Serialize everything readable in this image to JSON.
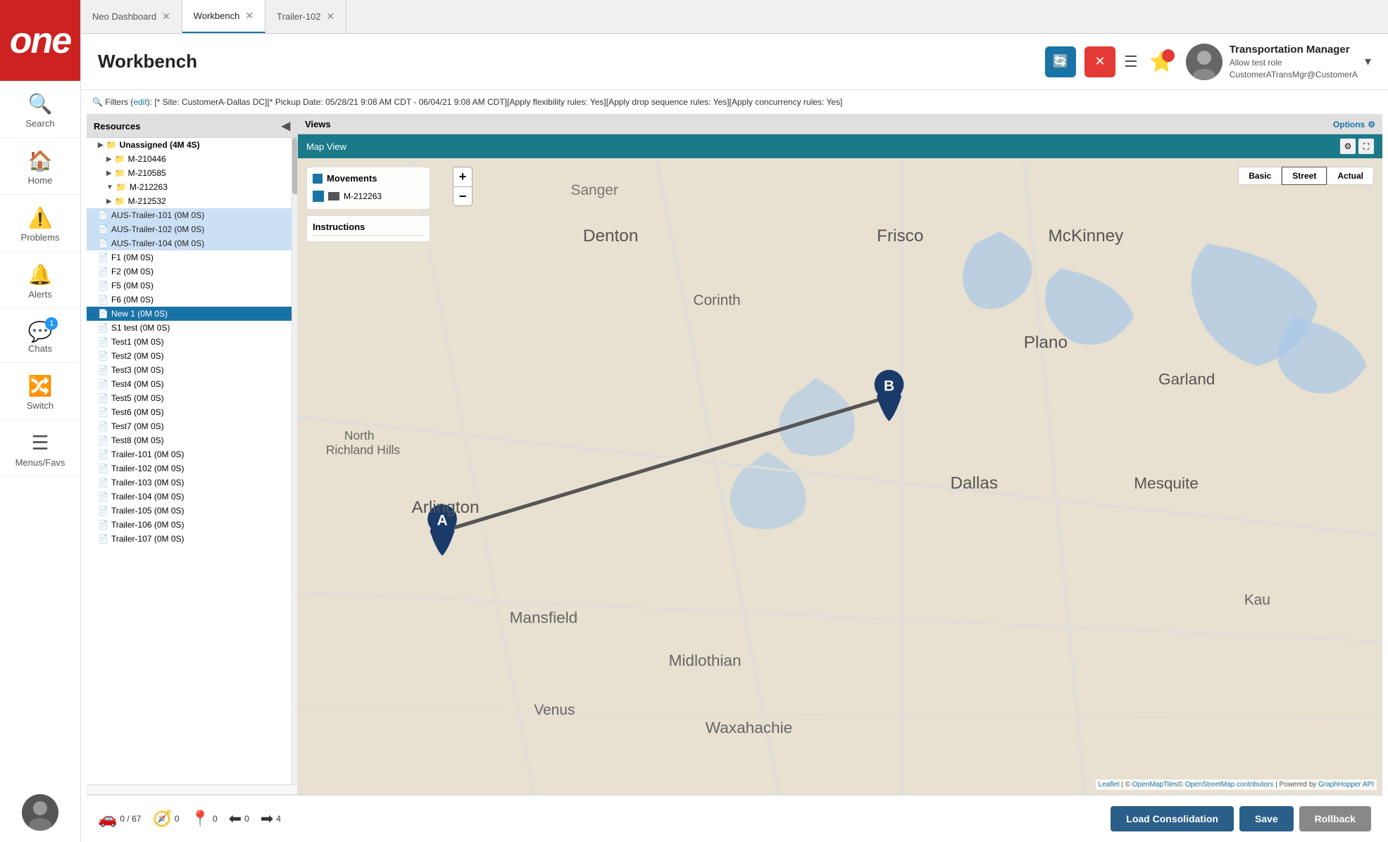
{
  "app": {
    "logo_text": "one"
  },
  "sidebar": {
    "items": [
      {
        "id": "search",
        "label": "Search",
        "icon": "🔍"
      },
      {
        "id": "home",
        "label": "Home",
        "icon": "🏠"
      },
      {
        "id": "problems",
        "label": "Problems",
        "icon": "⚠️"
      },
      {
        "id": "alerts",
        "label": "Alerts",
        "icon": "🔔"
      },
      {
        "id": "chats",
        "label": "Chats",
        "icon": "💬",
        "badge": "1"
      },
      {
        "id": "switch",
        "label": "Switch",
        "icon": "🔀"
      },
      {
        "id": "menus",
        "label": "Menus/Favs",
        "icon": "☰"
      }
    ]
  },
  "tabs": [
    {
      "id": "neo-dashboard",
      "label": "Neo Dashboard",
      "active": false
    },
    {
      "id": "workbench",
      "label": "Workbench",
      "active": true
    },
    {
      "id": "trailer-102",
      "label": "Trailer-102",
      "active": false
    }
  ],
  "header": {
    "title": "Workbench"
  },
  "user": {
    "name": "Transportation Manager",
    "role": "Allow test role",
    "email": "CustomerATransMgr@CustomerA"
  },
  "filter_bar": {
    "label": "Filters",
    "edit_link": "edit",
    "filter_text": "[* Site: CustomerA-Dallas DC][* Pickup Date: 05/28/21 9:08 AM CDT - 06/04/21 9:08 AM CDT][Apply flexibility rules: Yes][Apply drop sequence rules: Yes][Apply concurrency rules: Yes]"
  },
  "resources_panel": {
    "title": "Resources",
    "items": [
      {
        "id": "unassigned",
        "label": "Unassigned (4M 4S)",
        "type": "group",
        "level": 0
      },
      {
        "id": "m-210446",
        "label": "M-210446",
        "type": "folder",
        "level": 1
      },
      {
        "id": "m-210585",
        "label": "M-210585",
        "type": "folder",
        "level": 1
      },
      {
        "id": "m-212263",
        "label": "M-212263",
        "type": "folder-active",
        "level": 1
      },
      {
        "id": "m-212532",
        "label": "M-212532",
        "type": "folder",
        "level": 1
      },
      {
        "id": "aus-trailer-101",
        "label": "AUS-Trailer-101 (0M 0S)",
        "type": "doc",
        "level": 0,
        "highlighted": true
      },
      {
        "id": "aus-trailer-102",
        "label": "AUS-Trailer-102 (0M 0S)",
        "type": "doc",
        "level": 0,
        "highlighted": true
      },
      {
        "id": "aus-trailer-104",
        "label": "AUS-Trailer-104 (0M 0S)",
        "type": "doc",
        "level": 0,
        "highlighted": true
      },
      {
        "id": "f1",
        "label": "F1 (0M 0S)",
        "type": "doc",
        "level": 0
      },
      {
        "id": "f2",
        "label": "F2 (0M 0S)",
        "type": "doc",
        "level": 0
      },
      {
        "id": "f5",
        "label": "F5 (0M 0S)",
        "type": "doc",
        "level": 0
      },
      {
        "id": "f6",
        "label": "F6 (0M 0S)",
        "type": "doc",
        "level": 0
      },
      {
        "id": "new1",
        "label": "New 1 (0M 0S)",
        "type": "doc",
        "level": 0,
        "highlighted_blue": true
      },
      {
        "id": "s1test",
        "label": "S1 test (0M 0S)",
        "type": "doc",
        "level": 0
      },
      {
        "id": "test1",
        "label": "Test1 (0M 0S)",
        "type": "doc",
        "level": 0
      },
      {
        "id": "test2",
        "label": "Test2 (0M 0S)",
        "type": "doc",
        "level": 0
      },
      {
        "id": "test3",
        "label": "Test3 (0M 0S)",
        "type": "doc",
        "level": 0
      },
      {
        "id": "test4",
        "label": "Test4 (0M 0S)",
        "type": "doc",
        "level": 0
      },
      {
        "id": "test5",
        "label": "Test5 (0M 0S)",
        "type": "doc",
        "level": 0
      },
      {
        "id": "test6",
        "label": "Test6 (0M 0S)",
        "type": "doc",
        "level": 0
      },
      {
        "id": "test7",
        "label": "Test7 (0M 0S)",
        "type": "doc",
        "level": 0
      },
      {
        "id": "test8",
        "label": "Test8 (0M 0S)",
        "type": "doc",
        "level": 0
      },
      {
        "id": "trailer-101",
        "label": "Trailer-101 (0M 0S)",
        "type": "doc",
        "level": 0
      },
      {
        "id": "trailer-102",
        "label": "Trailer-102 (0M 0S)",
        "type": "doc",
        "level": 0
      },
      {
        "id": "trailer-103",
        "label": "Trailer-103 (0M 0S)",
        "type": "doc",
        "level": 0
      },
      {
        "id": "trailer-104",
        "label": "Trailer-104 (0M 0S)",
        "type": "doc",
        "level": 0
      },
      {
        "id": "trailer-105",
        "label": "Trailer-105 (0M 0S)",
        "type": "doc",
        "level": 0
      },
      {
        "id": "trailer-106",
        "label": "Trailer-106 (0M 0S)",
        "type": "doc",
        "level": 0
      },
      {
        "id": "trailer-107",
        "label": "Trailer-107 (0M 0S)",
        "type": "doc",
        "level": 0
      }
    ]
  },
  "views_panel": {
    "title": "Views",
    "options_label": "Options"
  },
  "map": {
    "title": "Map View",
    "movements_label": "Movements",
    "movement_item": "M-212263",
    "instructions_label": "Instructions",
    "type_buttons": [
      "Basic",
      "Street",
      "Actual"
    ],
    "active_type": "Street",
    "cities": [
      "Denton",
      "Corinth",
      "Frisco",
      "McKinney",
      "Plano",
      "Garland",
      "Dallas",
      "Mesquite",
      "Arlington",
      "Mansfield",
      "Midlothian",
      "Venus",
      "Waxahachie"
    ],
    "attribution": "Leaflet | © OpenMapTiles© OpenStreetMap contributors | Powered by GraphHopper API",
    "zoom_plus": "+",
    "zoom_minus": "−"
  },
  "bottom_toolbar": {
    "stats": [
      {
        "id": "trucks",
        "icon": "🚗",
        "value": "0 / 67"
      },
      {
        "id": "nav",
        "icon": "🧭",
        "value": "0"
      },
      {
        "id": "pin",
        "icon": "📍",
        "value": "0"
      },
      {
        "id": "back",
        "icon": "⬅",
        "value": "0"
      },
      {
        "id": "forward",
        "icon": "➡",
        "value": "4"
      }
    ],
    "load_consolidation_label": "Load Consolidation",
    "save_label": "Save",
    "rollback_label": "Rollback"
  }
}
